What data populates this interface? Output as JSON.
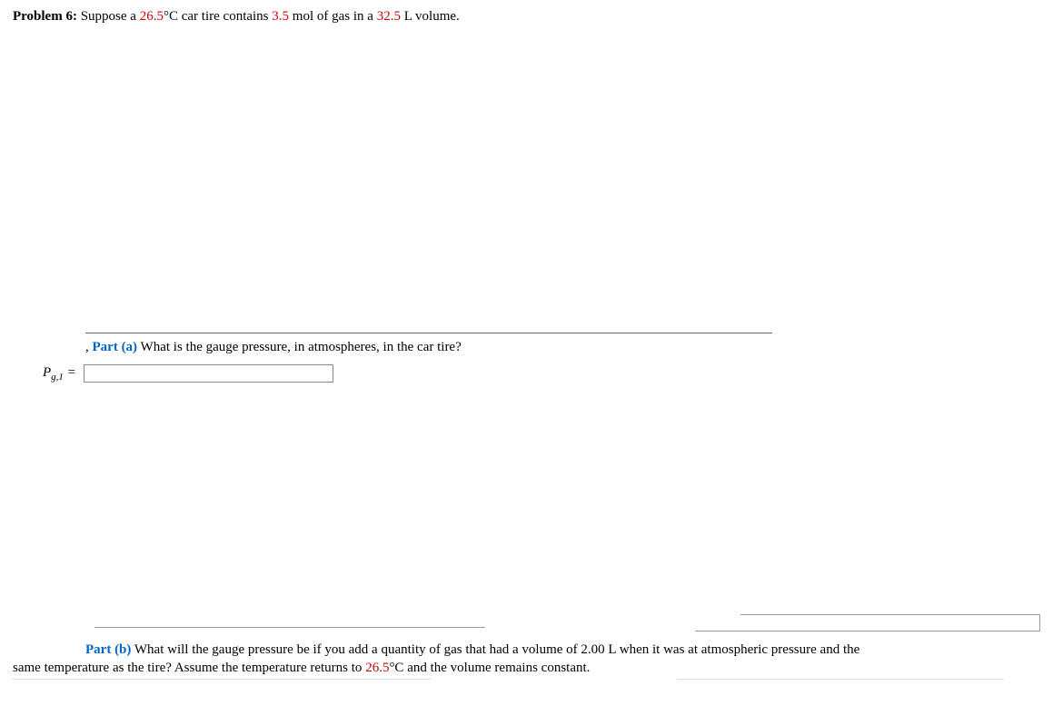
{
  "problem": {
    "label": "Problem 6:",
    "text_before_temp": "Suppose a ",
    "temp_value": "26.5",
    "temp_unit": "°C",
    "text_mid1": " car tire contains ",
    "mol_value": "3.5",
    "text_mid2": " mol of gas in a ",
    "vol_value": "32.5",
    "text_after": " L volume."
  },
  "part_a": {
    "label": "Part (a)",
    "question": "What is the gauge pressure, in atmospheres, in the car tire?",
    "symbol_main": "P",
    "symbol_sub": "g,1",
    "equals": " = ",
    "input_value": ""
  },
  "part_b": {
    "label": "Part (b)",
    "text1": "What will the gauge pressure be if you add a quantity of gas that had a volume of 2.00 L when it was at atmospheric pressure and the",
    "text2_before": "same temperature as the tire? Assume the temperature returns to ",
    "temp_value": "26.5",
    "temp_unit": "°C",
    "text2_after": " and the volume remains constant."
  },
  "marker": ","
}
